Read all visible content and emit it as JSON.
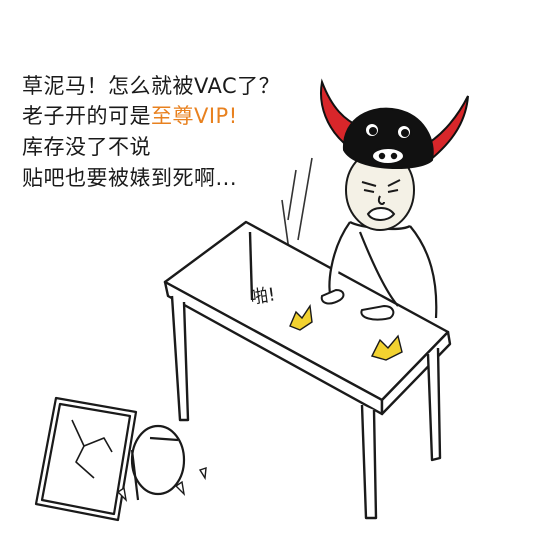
{
  "caption": {
    "line1": "草泥马！怎么就被VAC了？",
    "line2_prefix": "老子开的可是",
    "line2_highlight": "至尊VIP!",
    "line3": "库存没了不说",
    "line4": "贴吧也要被婊到死啊..."
  },
  "sound_effect": "啪!",
  "colors": {
    "text": "#1a1a1a",
    "highlight": "#e8811f",
    "horn_red": "#d8262a",
    "helmet_black": "#111111",
    "impact_yellow": "#f2d230"
  }
}
